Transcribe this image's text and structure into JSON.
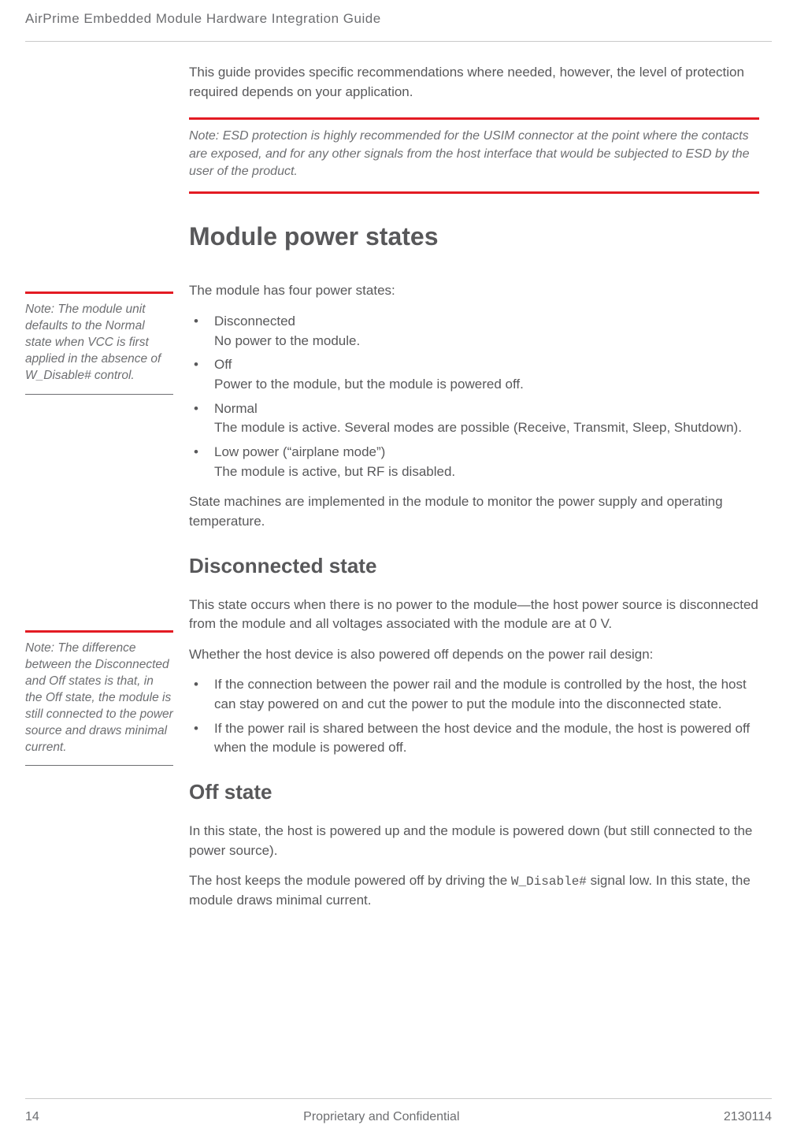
{
  "header": {
    "running_title": "AirPrime Embedded Module Hardware Integration Guide"
  },
  "intro": {
    "para": "This guide provides specific recommendations where needed, however, the level of protection required depends on your application.",
    "note_lead": "Note:",
    "note_body": " ESD protection is highly recommended for the USIM connector at the point where the contacts are exposed, and for any other signals from the host interface that would be subjected to ESD by the user of the product."
  },
  "section": {
    "title": "Module power states",
    "intro": "The module has four power states:",
    "states": [
      {
        "name": "Disconnected",
        "desc": "No power to the module."
      },
      {
        "name": "Off",
        "desc": "Power to the module, but the module is powered off."
      },
      {
        "name": "Normal",
        "desc": "The module is active. Several modes are possible (Receive, Transmit, Sleep, Shutdown)."
      },
      {
        "name": "Low power (“airplane mode”)",
        "desc": "The module is active, but RF is disabled."
      }
    ],
    "closing": "State machines are implemented in the module to monitor the power supply and operating temperature."
  },
  "side_notes": {
    "n1_lead": "Note:",
    "n1_body": " The module unit defaults to the Normal state when VCC is first applied in the absence of W_Disable# control.",
    "n2_lead": "Note:",
    "n2_body": " The difference between the Disconnected and Off states is that, in the Off state, the module is still connected to the power source and draws minimal current."
  },
  "disconnected": {
    "title": "Disconnected state",
    "p1": "This state occurs when there is no power to the module—the host power source is disconnected from the module and all voltages associated with the module are at 0 V.",
    "p2": "Whether the host device is also powered off depends on the power rail design:",
    "bullets": [
      "If the connection between the power rail and the module is controlled by the host, the host can stay powered on and cut the power to put the module into the disconnected state.",
      "If the power rail is shared between the host device and the module, the host is powered off when the module is powered off."
    ]
  },
  "off": {
    "title": "Off state",
    "p1": "In this state, the host is powered up and the module is powered down (but still connected to the power source).",
    "p2_pre": "The host keeps the module powered off by driving the ",
    "p2_code": "W_Disable#",
    "p2_post": " signal low. In this state, the module draws minimal current."
  },
  "footer": {
    "page": "14",
    "center": "Proprietary and Confidential",
    "right": "2130114"
  }
}
